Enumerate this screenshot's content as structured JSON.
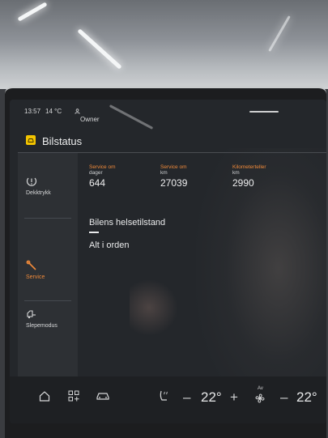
{
  "status_bar": {
    "time": "13:57",
    "outside_temp": "14 °C",
    "profile": "Owner"
  },
  "header": {
    "title": "Bilstatus",
    "icon": "car-status-icon",
    "accent_color": "#f3c400"
  },
  "sidebar": {
    "items": [
      {
        "label": "Dekktrykk",
        "icon": "tire-pressure-icon",
        "active": false
      },
      {
        "label": "Service",
        "icon": "wrench-icon",
        "active": true
      },
      {
        "label": "Slepemodus",
        "icon": "tow-mode-icon",
        "active": false
      }
    ],
    "active_color": "#f08a3a"
  },
  "stats": [
    {
      "label": "Service om",
      "unit": "dager",
      "value": "644"
    },
    {
      "label": "Service om",
      "unit": "km",
      "value": "27039"
    },
    {
      "label": "Kilometerteller",
      "unit": "km",
      "value": "2990"
    }
  ],
  "health": {
    "title": "Bilens helsetilstand",
    "status": "Alt i orden"
  },
  "climate_bar": {
    "icons": [
      "home-icon",
      "apps-icon",
      "car-icon",
      "seat-heat-icon",
      "fan-icon"
    ],
    "left_temp": "22°",
    "right_temp": "22°",
    "minus": "–",
    "plus": "+",
    "fan_label": "Av"
  }
}
